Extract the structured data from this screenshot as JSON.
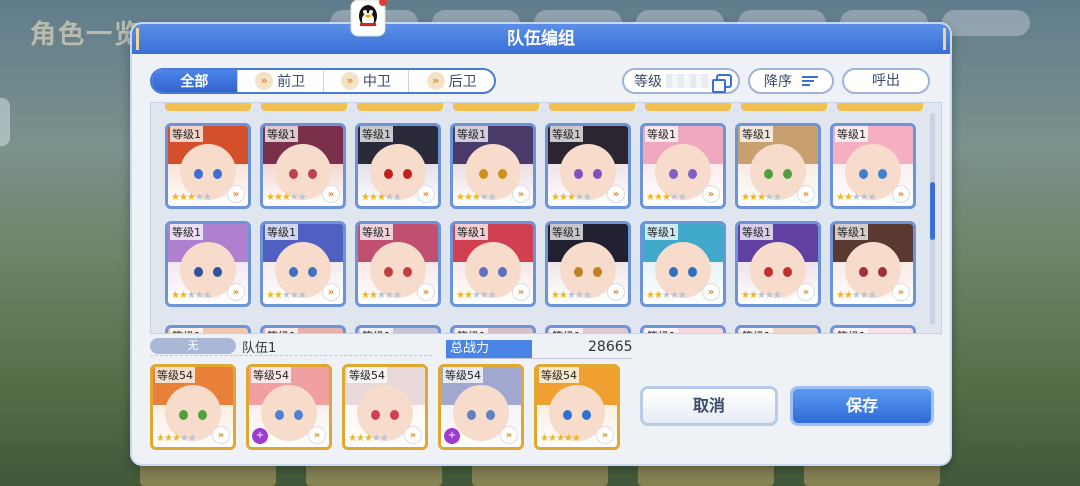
{
  "background": {
    "title": "角色一览"
  },
  "dialog": {
    "title": "队伍编组"
  },
  "filters": {
    "tabs": [
      {
        "label": "全部",
        "active": true
      },
      {
        "label": "前卫",
        "active": false
      },
      {
        "label": "中卫",
        "active": false
      },
      {
        "label": "后卫",
        "active": false
      }
    ]
  },
  "sort": {
    "field_label": "等级",
    "order_label": "降序",
    "call_label": "呼出"
  },
  "roster": {
    "row1": [
      {
        "level": "等级1",
        "stars": 3,
        "max_stars": 5
      },
      {
        "level": "等级1",
        "stars": 3,
        "max_stars": 5
      },
      {
        "level": "等级1",
        "stars": 3,
        "max_stars": 5
      },
      {
        "level": "等级1",
        "stars": 3,
        "max_stars": 5
      },
      {
        "level": "等级1",
        "stars": 3,
        "max_stars": 5
      },
      {
        "level": "等级1",
        "stars": 3,
        "max_stars": 5
      },
      {
        "level": "等级1",
        "stars": 3,
        "max_stars": 5
      },
      {
        "level": "等级1",
        "stars": 2,
        "max_stars": 5
      }
    ],
    "row2": [
      {
        "level": "等级1",
        "stars": 2,
        "max_stars": 5
      },
      {
        "level": "等级1",
        "stars": 2,
        "max_stars": 5
      },
      {
        "level": "等级1",
        "stars": 2,
        "max_stars": 5
      },
      {
        "level": "等级1",
        "stars": 2,
        "max_stars": 5
      },
      {
        "level": "等级1",
        "stars": 2,
        "max_stars": 5
      },
      {
        "level": "等级1",
        "stars": 2,
        "max_stars": 5
      },
      {
        "level": "等级1",
        "stars": 2,
        "max_stars": 5
      },
      {
        "level": "等级1",
        "stars": 2,
        "max_stars": 5
      }
    ],
    "row3_label": "等级1",
    "scroll_position": 0.45
  },
  "team": {
    "tag": "无",
    "name": "队伍1",
    "power_label": "总战力",
    "power_value": "28665",
    "members": [
      {
        "level": "等级54",
        "stars": 3,
        "max_stars": 5,
        "rank_up": false
      },
      {
        "level": "等级54",
        "stars": 0,
        "max_stars": 5,
        "rank_up": true
      },
      {
        "level": "等级54",
        "stars": 3,
        "max_stars": 5,
        "rank_up": false
      },
      {
        "level": "等级54",
        "stars": 0,
        "max_stars": 5,
        "rank_up": true
      },
      {
        "level": "等级54",
        "stars": 5,
        "max_stars": 5,
        "rank_up": false
      }
    ]
  },
  "buttons": {
    "cancel": "取消",
    "save": "保存"
  },
  "icons": {
    "position": "chevron-icon",
    "rank": "rank-up-icon",
    "qq": "qq-penguin-icon"
  },
  "colors": {
    "accent": "#3a6fd6",
    "card_border": "#6d94d8",
    "team_border": "#e0a830",
    "star": "#f3b51f"
  }
}
